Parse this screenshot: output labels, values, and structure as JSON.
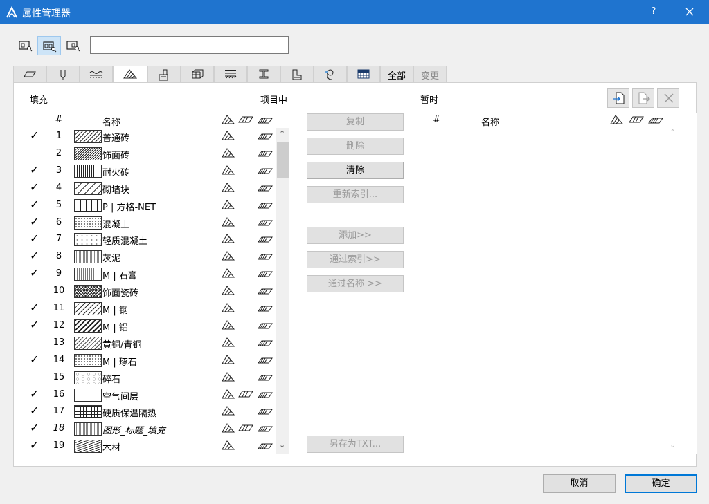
{
  "window": {
    "title": "属性管理器",
    "help": "?"
  },
  "search": {
    "value": "",
    "placeholder": ""
  },
  "tabs": {
    "all_label": "全部",
    "changes_label": "变更"
  },
  "left": {
    "heading": "填充",
    "section_label": "项目中",
    "col_num": "#",
    "col_name": "名称",
    "rows": [
      {
        "checked": "✓",
        "num": "1",
        "name": "普通砖",
        "pattern": "hatch-light",
        "c1": true,
        "c2": false,
        "c3": true
      },
      {
        "checked": "",
        "num": "2",
        "name": "饰面砖",
        "pattern": "hatch-dense",
        "c1": true,
        "c2": false,
        "c3": true
      },
      {
        "checked": "✓",
        "num": "3",
        "name": "耐火砖",
        "pattern": "vert-dense",
        "c1": true,
        "c2": false,
        "c3": true
      },
      {
        "checked": "✓",
        "num": "4",
        "name": "砌墙块",
        "pattern": "hatch-wide",
        "c1": true,
        "c2": false,
        "c3": true
      },
      {
        "checked": "✓",
        "num": "5",
        "name": "P | 方格-NET",
        "pattern": "grid",
        "c1": true,
        "c2": false,
        "c3": true
      },
      {
        "checked": "✓",
        "num": "6",
        "name": "混凝土",
        "pattern": "dots",
        "c1": true,
        "c2": false,
        "c3": true
      },
      {
        "checked": "✓",
        "num": "7",
        "name": "轻质混凝土",
        "pattern": "dots-sparse",
        "c1": true,
        "c2": false,
        "c3": true
      },
      {
        "checked": "✓",
        "num": "8",
        "name": "灰泥",
        "pattern": "fine",
        "c1": true,
        "c2": false,
        "c3": true
      },
      {
        "checked": "✓",
        "num": "9",
        "name": "M | 石膏",
        "pattern": "fine-grid",
        "c1": true,
        "c2": false,
        "c3": true
      },
      {
        "checked": "",
        "num": "10",
        "name": "饰面瓷砖",
        "pattern": "cross-dense",
        "c1": true,
        "c2": false,
        "c3": true
      },
      {
        "checked": "✓",
        "num": "11",
        "name": "M | 钢",
        "pattern": "hatch-medium",
        "c1": true,
        "c2": false,
        "c3": true
      },
      {
        "checked": "✓",
        "num": "12",
        "name": "M | 铝",
        "pattern": "hatch-double",
        "c1": true,
        "c2": false,
        "c3": true
      },
      {
        "checked": "",
        "num": "13",
        "name": "黄铜/青铜",
        "pattern": "hatch-dash",
        "c1": true,
        "c2": false,
        "c3": true
      },
      {
        "checked": "✓",
        "num": "14",
        "name": "M | 琢石",
        "pattern": "dots",
        "c1": true,
        "c2": false,
        "c3": true
      },
      {
        "checked": "",
        "num": "15",
        "name": "碎石",
        "pattern": "gravel",
        "c1": true,
        "c2": false,
        "c3": true
      },
      {
        "checked": "✓",
        "num": "16",
        "name": "空气间层",
        "pattern": "empty",
        "c1": true,
        "c2": true,
        "c3": true
      },
      {
        "checked": "✓",
        "num": "17",
        "name": "硬质保温隔热",
        "pattern": "grid-dense",
        "c1": true,
        "c2": false,
        "c3": true
      },
      {
        "checked": "✓",
        "num": "18",
        "name": "图形_标题_填充",
        "pattern": "fine",
        "c1": true,
        "c2": true,
        "c3": true,
        "italic": true
      },
      {
        "checked": "✓",
        "num": "19",
        "name": "木材",
        "pattern": "wood",
        "c1": true,
        "c2": false,
        "c3": true
      }
    ]
  },
  "buttons": {
    "copy": "复制",
    "delete": "删除",
    "clear": "清除",
    "reindex": "重新索引...",
    "add": "添加>>",
    "by_index": "通过索引>>",
    "by_name": "通过名称 >>",
    "save_txt": "另存为TXT..."
  },
  "right": {
    "heading": "暂时",
    "col_num": "#",
    "col_name": "名称"
  },
  "dialog": {
    "cancel": "取消",
    "ok": "确定"
  },
  "icons": {
    "app": "archicad-icon",
    "close": "close-icon",
    "tab_icons": [
      "wall-icon",
      "pen-icon",
      "line-type-icon",
      "fill-icon",
      "surface-icon",
      "building-material-icon",
      "composite-icon",
      "profile-icon",
      "zone-icon",
      "mep-icon",
      "markup-icon"
    ]
  },
  "colors": {
    "titlebar": "#1f74cf",
    "focus": "#0078d7"
  }
}
